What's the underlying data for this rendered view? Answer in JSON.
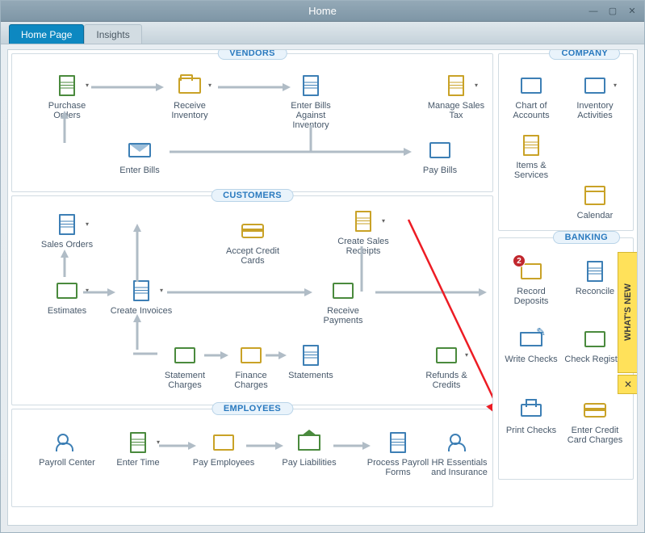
{
  "window": {
    "title": "Home"
  },
  "tabs": {
    "home": "Home Page",
    "insights": "Insights",
    "active": "home"
  },
  "sections": {
    "vendors": {
      "label": "VENDORS",
      "items": {
        "purchase_orders": "Purchase Orders",
        "receive_inventory": "Receive Inventory",
        "enter_bills_inv": "Enter Bills Against Inventory",
        "manage_sales_tax": "Manage Sales Tax",
        "enter_bills": "Enter Bills",
        "pay_bills": "Pay Bills"
      }
    },
    "customers": {
      "label": "CUSTOMERS",
      "items": {
        "sales_orders": "Sales Orders",
        "accept_cards": "Accept Credit Cards",
        "sales_receipts": "Create Sales Receipts",
        "estimates": "Estimates",
        "create_invoices": "Create Invoices",
        "receive_payments": "Receive Payments",
        "statement_charges": "Statement Charges",
        "finance_charges": "Finance Charges",
        "statements": "Statements",
        "refunds": "Refunds & Credits"
      }
    },
    "employees": {
      "label": "EMPLOYEES",
      "items": {
        "payroll_center": "Payroll Center",
        "enter_time": "Enter Time",
        "pay_employees": "Pay Employees",
        "pay_liabilities": "Pay Liabilities",
        "process_payroll": "Process Payroll Forms",
        "hr": "HR Essentials and Insurance"
      }
    },
    "company": {
      "label": "COMPANY",
      "items": {
        "chart_of_accounts": "Chart of Accounts",
        "inventory_activities": "Inventory Activities",
        "items_services": "Items & Services",
        "calendar": "Calendar"
      }
    },
    "banking": {
      "label": "BANKING",
      "items": {
        "record_deposits": "Record Deposits",
        "reconcile": "Reconcile",
        "write_checks": "Write Checks",
        "check_register": "Check Register",
        "print_checks": "Print Checks",
        "enter_cc": "Enter Credit Card Charges"
      },
      "badges": {
        "record_deposits": "2"
      }
    }
  },
  "whats_new": {
    "label": "WHAT'S NEW",
    "close": "✕"
  }
}
